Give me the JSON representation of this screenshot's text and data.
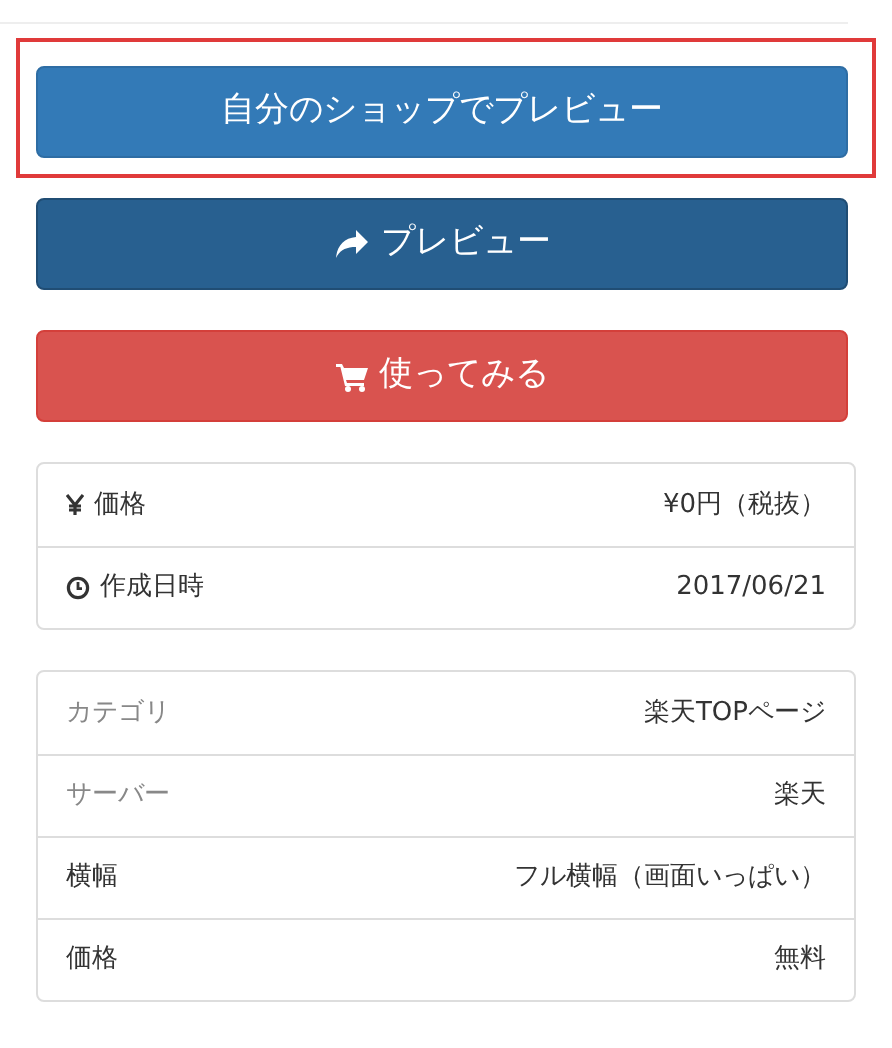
{
  "buttons": [
    {
      "kind": "primary",
      "label": "自分のショップでプレビュー",
      "highlighted": true
    },
    {
      "kind": "share",
      "label": "プレビュー",
      "highlighted": false
    },
    {
      "kind": "cart",
      "label": "使ってみる",
      "highlighted": false
    }
  ],
  "info": [
    {
      "kind": "yen",
      "label": "価格",
      "value": "¥0円（税抜）"
    },
    {
      "kind": "clock",
      "label": "作成日時",
      "value": "2017/06/21"
    }
  ],
  "details": [
    {
      "label": "カテゴリ",
      "value": "楽天TOPページ",
      "muted": true
    },
    {
      "label": "サーバー",
      "value": "楽天",
      "muted": true
    },
    {
      "label": "横幅",
      "value": "フル横幅（画面いっぱい）",
      "muted": false
    },
    {
      "label": "価格",
      "value": "無料",
      "muted": false
    }
  ]
}
